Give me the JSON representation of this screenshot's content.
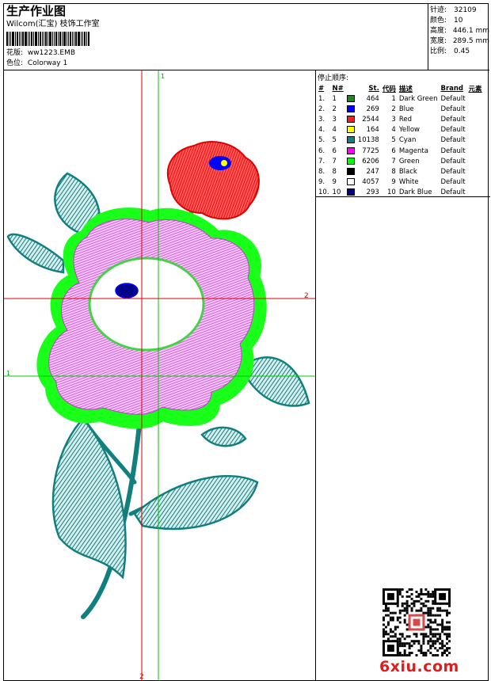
{
  "header": {
    "title": "生产作业图",
    "company": "Wilcom(汇宝) 枝饰工作室",
    "design_label": "花版:",
    "design_value": "ww1223.EMB",
    "colorway_label": "色位:",
    "colorway_value": "Colorway 1"
  },
  "stats": [
    {
      "label": "针迹:",
      "value": "32109"
    },
    {
      "label": "颜色:",
      "value": "10"
    },
    {
      "label": "高度:",
      "value": "446.1 mm"
    },
    {
      "label": "宽度:",
      "value": "289.5 mm"
    },
    {
      "label": "比例:",
      "value": "0.45"
    }
  ],
  "sequence": {
    "title": "停止顺序:",
    "headers": [
      "#",
      "N#",
      "St.",
      "代码",
      "描述",
      "Brand",
      "元素"
    ],
    "rows": [
      {
        "idx": "1.",
        "n": "1",
        "color": "#1a8a1a",
        "st": "464",
        "code": "1",
        "desc": "Dark Green",
        "brand": "Default"
      },
      {
        "idx": "2.",
        "n": "2",
        "color": "#0000ff",
        "st": "269",
        "code": "2",
        "desc": "Blue",
        "brand": "Default"
      },
      {
        "idx": "3.",
        "n": "3",
        "color": "#ff1a1a",
        "st": "2544",
        "code": "3",
        "desc": "Red",
        "brand": "Default"
      },
      {
        "idx": "4.",
        "n": "4",
        "color": "#ffff00",
        "st": "164",
        "code": "4",
        "desc": "Yellow",
        "brand": "Default"
      },
      {
        "idx": "5.",
        "n": "5",
        "color": "#127f7f",
        "st": "10138",
        "code": "5",
        "desc": "Cyan",
        "brand": "Default"
      },
      {
        "idx": "6.",
        "n": "6",
        "color": "#ff00ff",
        "st": "7725",
        "code": "6",
        "desc": "Magenta",
        "brand": "Default"
      },
      {
        "idx": "7.",
        "n": "7",
        "color": "#00ff00",
        "st": "6206",
        "code": "7",
        "desc": "Green",
        "brand": "Default"
      },
      {
        "idx": "8.",
        "n": "8",
        "color": "#000000",
        "st": "247",
        "code": "8",
        "desc": "Black",
        "brand": "Default"
      },
      {
        "idx": "9.",
        "n": "9",
        "color": "#ffffff",
        "st": "4057",
        "code": "9",
        "desc": "White",
        "brand": "Default"
      },
      {
        "idx": "10.",
        "n": "10",
        "color": "#00008b",
        "st": "293",
        "code": "10",
        "desc": "Dark Blue",
        "brand": "Default"
      }
    ]
  },
  "guides": {
    "v1": "1",
    "h2": "2",
    "h1": "1",
    "v2": "2"
  },
  "footer": {
    "site": "6xiu.com"
  },
  "colors": {
    "guide_red": "#e00000",
    "guide_green": "#00c800",
    "teal": "#127f7f",
    "magenta": "#e25ce6",
    "lime": "#19ff19"
  }
}
